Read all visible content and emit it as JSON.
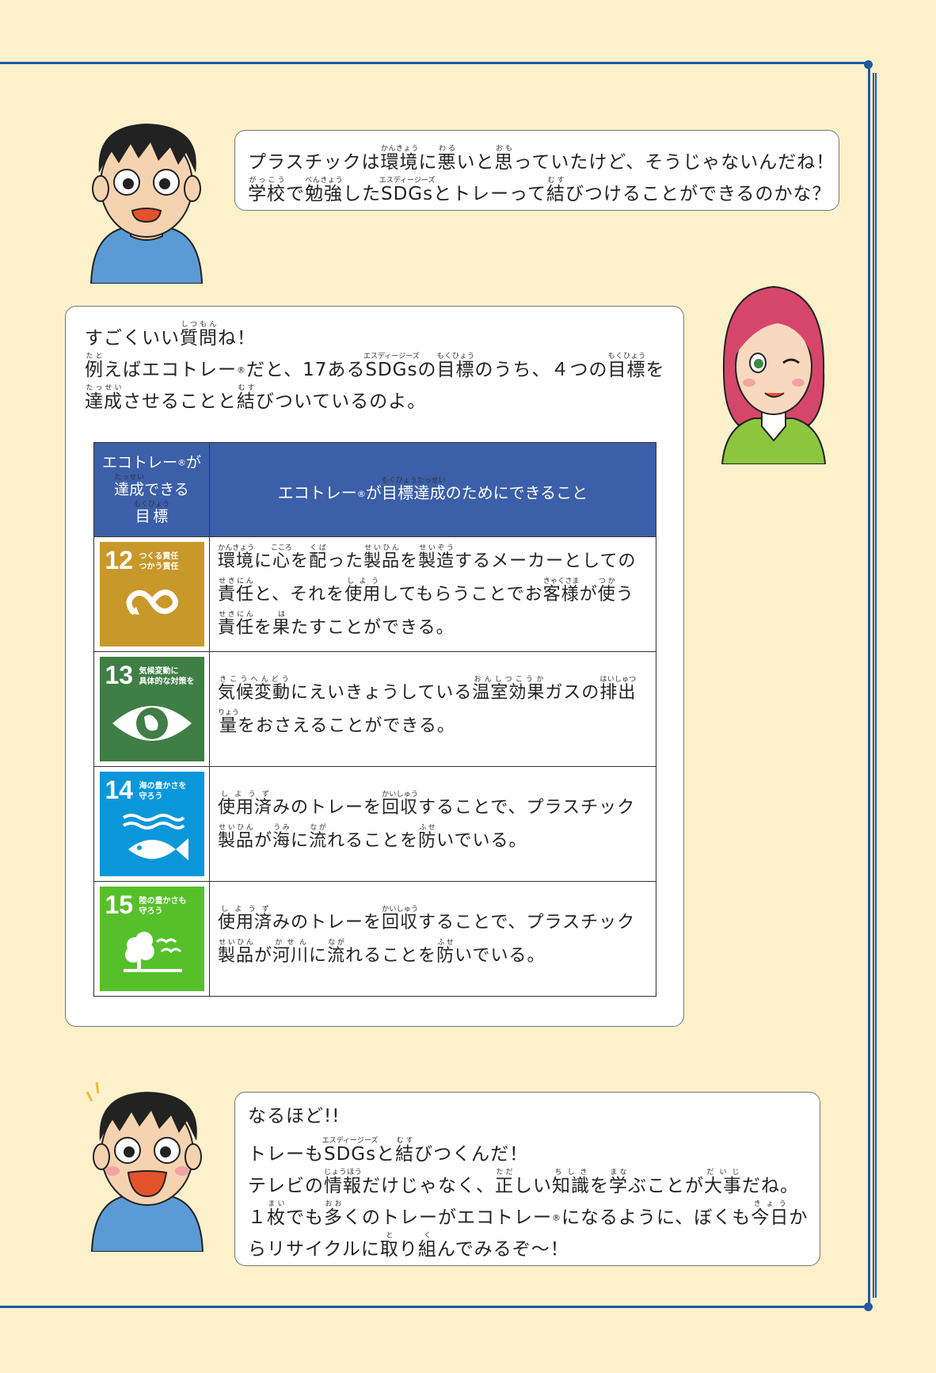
{
  "bubble1": {
    "line1": [
      {
        "t": "プラスチックは"
      },
      {
        "t": "環境",
        "r": "かんきょう"
      },
      {
        "t": "に"
      },
      {
        "t": "悪",
        "r": "わる"
      },
      {
        "t": "いと"
      },
      {
        "t": "思",
        "r": "おも"
      },
      {
        "t": "っていたけど、そうじゃないんだね！"
      }
    ],
    "line2": [
      {
        "t": "学校",
        "r": "がっこう"
      },
      {
        "t": "で"
      },
      {
        "t": "勉強",
        "r": "べんきょう"
      },
      {
        "t": "した"
      },
      {
        "t": "SDGs",
        "r": "エスディージーズ"
      },
      {
        "t": "とトレーって"
      },
      {
        "t": "結",
        "r": "むす"
      },
      {
        "t": "びつけることができるのかな？"
      }
    ]
  },
  "bubble2": {
    "line1": [
      {
        "t": "すごくいい"
      },
      {
        "t": "質問",
        "r": "しつもん"
      },
      {
        "t": "ね！"
      }
    ],
    "line2": [
      {
        "t": "例",
        "r": "たと"
      },
      {
        "t": "えばエコトレー"
      },
      {
        "t": "®",
        "reg": true
      },
      {
        "t": "だと、17ある"
      },
      {
        "t": "SDGs",
        "r": "エスディージーズ"
      },
      {
        "t": "の"
      },
      {
        "t": "目標",
        "r": "もくひょう"
      },
      {
        "t": "のうち、４つの"
      },
      {
        "t": "目標",
        "r": "もくひょう"
      },
      {
        "t": "を"
      }
    ],
    "line3": [
      {
        "t": "達成",
        "r": "たっせい"
      },
      {
        "t": "させることと"
      },
      {
        "t": "結",
        "r": "むす"
      },
      {
        "t": "びついているのよ。"
      }
    ]
  },
  "table": {
    "header_col1": [
      [
        {
          "t": "エコトレー"
        },
        {
          "t": "®",
          "reg": true
        },
        {
          "t": "が"
        }
      ],
      [
        {
          "t": "達成",
          "r": "たっせい"
        },
        {
          "t": "できる"
        }
      ],
      [
        {
          "t": "目標",
          "r": "もくひょう"
        }
      ]
    ],
    "header_col2": [
      {
        "t": "エコトレー"
      },
      {
        "t": "®",
        "reg": true
      },
      {
        "t": "が"
      },
      {
        "t": "目標達成",
        "r": "もくひょうたっせい"
      },
      {
        "t": "のためにできること"
      }
    ],
    "rows": [
      {
        "goal_number": "12",
        "goal_title": "つくる責任\nつかう責任",
        "color": "#c9982b",
        "icon": "infinity-icon",
        "lines": [
          [
            {
              "t": "環境",
              "r": "かんきょう"
            },
            {
              "t": "に"
            },
            {
              "t": "心",
              "r": "こころ"
            },
            {
              "t": "を"
            },
            {
              "t": "配",
              "r": "くば"
            },
            {
              "t": "った"
            },
            {
              "t": "製品",
              "r": "せいひん"
            },
            {
              "t": "を"
            },
            {
              "t": "製造",
              "r": "せいぞう"
            },
            {
              "t": "するメーカーとしての"
            }
          ],
          [
            {
              "t": "責任",
              "r": "せきにん"
            },
            {
              "t": "と、それを"
            },
            {
              "t": "使用",
              "r": "しよう"
            },
            {
              "t": "してもらうことでお"
            },
            {
              "t": "客様",
              "r": "きゃくさま"
            },
            {
              "t": "が"
            },
            {
              "t": "使",
              "r": "つか"
            },
            {
              "t": "う"
            }
          ],
          [
            {
              "t": "責任",
              "r": "せきにん"
            },
            {
              "t": "を"
            },
            {
              "t": "果",
              "r": "は"
            },
            {
              "t": "たすことができる。"
            }
          ]
        ]
      },
      {
        "goal_number": "13",
        "goal_title": "気候変動に\n具体的な対策を",
        "color": "#3f7e44",
        "icon": "eye-globe-icon",
        "lines": [
          [
            {
              "t": "気候変動",
              "r": "きこうへんどう"
            },
            {
              "t": "にえいきょうしている"
            },
            {
              "t": "温室効果",
              "r": "おんしつこうか"
            },
            {
              "t": "ガスの"
            },
            {
              "t": "排出",
              "r": "はいしゅつ"
            }
          ],
          [
            {
              "t": "量",
              "r": "りょう"
            },
            {
              "t": "をおさえることができる。"
            }
          ]
        ]
      },
      {
        "goal_number": "14",
        "goal_title": "海の豊かさを\n守ろう",
        "color": "#0a97d9",
        "icon": "fish-icon",
        "lines": [
          [
            {
              "t": "使用済",
              "r": "しようず"
            },
            {
              "t": "みのトレーを"
            },
            {
              "t": "回収",
              "r": "かいしゅう"
            },
            {
              "t": "することで、プラスチック"
            }
          ],
          [
            {
              "t": "製品",
              "r": "せいひん"
            },
            {
              "t": "が"
            },
            {
              "t": "海",
              "r": "うみ"
            },
            {
              "t": "に"
            },
            {
              "t": "流",
              "r": "なが"
            },
            {
              "t": "れることを"
            },
            {
              "t": "防",
              "r": "ふせ"
            },
            {
              "t": "いでいる。"
            }
          ]
        ]
      },
      {
        "goal_number": "15",
        "goal_title": "陸の豊かさも\n守ろう",
        "color": "#56c02b",
        "icon": "tree-birds-icon",
        "lines": [
          [
            {
              "t": "使用済",
              "r": "しようず"
            },
            {
              "t": "みのトレーを"
            },
            {
              "t": "回収",
              "r": "かいしゅう"
            },
            {
              "t": "することで、プラスチック"
            }
          ],
          [
            {
              "t": "製品",
              "r": "せいひん"
            },
            {
              "t": "が"
            },
            {
              "t": "河川",
              "r": "かせん"
            },
            {
              "t": "に"
            },
            {
              "t": "流",
              "r": "なが"
            },
            {
              "t": "れることを"
            },
            {
              "t": "防",
              "r": "ふせ"
            },
            {
              "t": "いでいる。"
            }
          ]
        ]
      }
    ]
  },
  "bubble3": {
    "line1": [
      {
        "t": "なるほど!!"
      }
    ],
    "line2": [
      {
        "t": "トレーも"
      },
      {
        "t": "SDGs",
        "r": "エスディージーズ"
      },
      {
        "t": "と"
      },
      {
        "t": "結",
        "r": "むす"
      },
      {
        "t": "びつくんだ！"
      }
    ],
    "line3": [
      {
        "t": "テレビの"
      },
      {
        "t": "情報",
        "r": "じょうほう"
      },
      {
        "t": "だけじゃなく、"
      },
      {
        "t": "正",
        "r": "ただ"
      },
      {
        "t": "しい"
      },
      {
        "t": "知識",
        "r": "ちしき"
      },
      {
        "t": "を"
      },
      {
        "t": "学",
        "r": "まな"
      },
      {
        "t": "ぶことが"
      },
      {
        "t": "大事",
        "r": "だいじ"
      },
      {
        "t": "だね。"
      }
    ],
    "line4": [
      {
        "t": "１"
      },
      {
        "t": "枚",
        "r": "まい"
      },
      {
        "t": "でも"
      },
      {
        "t": "多",
        "r": "おお"
      },
      {
        "t": "くのトレーがエコトレー"
      },
      {
        "t": "®",
        "reg": true
      },
      {
        "t": "になるように、ぼくも"
      },
      {
        "t": "今日",
        "r": "きょう"
      },
      {
        "t": "か"
      }
    ],
    "line5": [
      {
        "t": "らリサイクルに"
      },
      {
        "t": "取",
        "r": "と"
      },
      {
        "t": "り"
      },
      {
        "t": "組",
        "r": "く"
      },
      {
        "t": "んでみるぞ〜！"
      }
    ]
  },
  "colors": {
    "frame": "#1f5aa6",
    "background": "#fdf1cc",
    "table_header": "#3b5fa8"
  }
}
